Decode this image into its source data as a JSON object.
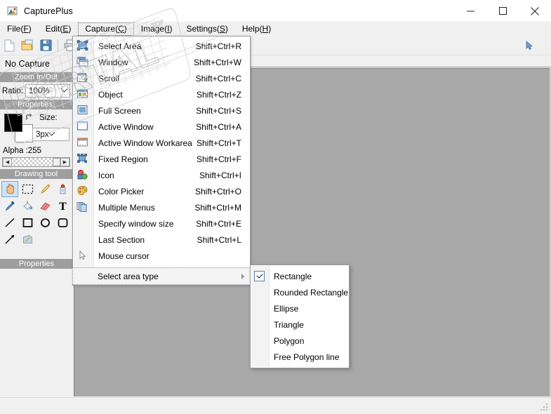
{
  "window": {
    "title": "CapturePlus",
    "app_icon": "app-logo-icon",
    "controls": {
      "minimize": "minimize-icon",
      "maximize": "maximize-icon",
      "close": "close-icon"
    }
  },
  "menubar": [
    {
      "label": "File(",
      "mnemonic": "F",
      "tail": ")",
      "name": "menu-file",
      "open": false
    },
    {
      "label": "Edit(",
      "mnemonic": "E",
      "tail": ")",
      "name": "menu-edit",
      "open": false
    },
    {
      "label": "Capture(",
      "mnemonic": "C",
      "tail": ")",
      "name": "menu-capture",
      "open": true
    },
    {
      "label": "Image(",
      "mnemonic": "I",
      "tail": ")",
      "name": "menu-image",
      "open": false
    },
    {
      "label": "Settings(",
      "mnemonic": "S",
      "tail": ")",
      "name": "menu-settings",
      "open": false
    },
    {
      "label": "Help(",
      "mnemonic": "H",
      "tail": ")",
      "name": "menu-help",
      "open": false
    }
  ],
  "toolbar": {
    "buttons": [
      {
        "name": "new-file-icon",
        "glyph": "new"
      },
      {
        "name": "open-file-icon",
        "glyph": "open"
      },
      {
        "name": "save-file-icon",
        "glyph": "save"
      },
      {
        "name": "print-icon",
        "glyph": "print"
      }
    ],
    "right_button": {
      "name": "pointer-tool-icon",
      "glyph": "pointer"
    }
  },
  "left_panel": {
    "capture_status": "No Capture",
    "zoom_section_title": "Zoom In/Out",
    "ratio_label": "Ratio:",
    "ratio_value": "100%",
    "properties_title": "Properties:",
    "size_label": "Size:",
    "size_value": "3px",
    "alpha_label": "Alpha :255",
    "alpha_value": 255,
    "foreground_color": "#000000",
    "background_color": "#ffffff",
    "drawing_tool_title": "Drawing tool",
    "properties_bottom_title": "Properties",
    "tools": [
      {
        "name": "hand-tool-icon",
        "glyph": "hand",
        "selected": true
      },
      {
        "name": "select-rect-tool-icon",
        "glyph": "marquee",
        "selected": false
      },
      {
        "name": "pencil-tool-icon",
        "glyph": "pencil",
        "selected": false
      },
      {
        "name": "spray-tool-icon",
        "glyph": "spray",
        "selected": false
      },
      {
        "name": "eyedropper-tool-icon",
        "glyph": "eyedropper",
        "selected": false
      },
      {
        "name": "paint-bucket-tool-icon",
        "glyph": "bucket",
        "selected": false
      },
      {
        "name": "eraser-tool-icon",
        "glyph": "eraser",
        "selected": false
      },
      {
        "name": "text-tool-icon",
        "glyph": "text",
        "selected": false
      },
      {
        "name": "line-tool-icon",
        "glyph": "line",
        "selected": false
      },
      {
        "name": "rectangle-tool-icon",
        "glyph": "rect",
        "selected": false
      },
      {
        "name": "ellipse-tool-icon",
        "glyph": "ellipse",
        "selected": false
      },
      {
        "name": "rounded-rect-tool-icon",
        "glyph": "roundrect",
        "selected": false
      },
      {
        "name": "arrow-tool-icon",
        "glyph": "arrow",
        "selected": false
      },
      {
        "name": "highlighter-tool-icon",
        "glyph": "highlight",
        "selected": false
      }
    ]
  },
  "capture_menu": {
    "items": [
      {
        "label": "Select Area",
        "accel": "Shift+Ctrl+R",
        "icon": "select-area-icon",
        "name": "menu-item-select-area"
      },
      {
        "label": "Window",
        "accel": "Shift+Ctrl+W",
        "icon": "window-icon",
        "name": "menu-item-window"
      },
      {
        "label": "Scroll",
        "accel": "Shift+Ctrl+C",
        "icon": "scroll-icon",
        "name": "menu-item-scroll"
      },
      {
        "label": "Object",
        "accel": "Shift+Ctrl+Z",
        "icon": "object-icon",
        "name": "menu-item-object"
      },
      {
        "label": "Full Screen",
        "accel": "Shift+Ctrl+S",
        "icon": "full-screen-icon",
        "name": "menu-item-full-screen"
      },
      {
        "label": "Active Window",
        "accel": "Shift+Ctrl+A",
        "icon": "active-window-icon",
        "name": "menu-item-active-window"
      },
      {
        "label": "Active Window Workarea",
        "accel": "Shift+Ctrl+T",
        "icon": "active-window-workarea-icon",
        "name": "menu-item-active-window-workarea"
      },
      {
        "label": "Fixed Region",
        "accel": "Shift+Ctrl+F",
        "icon": "fixed-region-icon",
        "name": "menu-item-fixed-region"
      },
      {
        "label": "Icon",
        "accel": "Shift+Ctrl+I",
        "icon": "icon-capture-icon",
        "name": "menu-item-icon"
      },
      {
        "label": "Color Picker",
        "accel": "Shift+Ctrl+O",
        "icon": "color-picker-icon",
        "name": "menu-item-color-picker"
      },
      {
        "label": "Multiple Menus",
        "accel": "Shift+Ctrl+M",
        "icon": "multiple-menus-icon",
        "name": "menu-item-multiple-menus"
      },
      {
        "label": "Specify window size",
        "accel": "Shift+Ctrl+E",
        "icon": "",
        "name": "menu-item-specify-window-size"
      },
      {
        "label": "Last Section",
        "accel": "Shift+Ctrl+L",
        "icon": "",
        "name": "menu-item-last-section"
      },
      {
        "label": "Mouse cursor",
        "accel": "",
        "icon": "mouse-cursor-icon",
        "name": "menu-item-mouse-cursor"
      }
    ],
    "submenu_parent": {
      "label": "Select area type",
      "name": "menu-item-select-area-type",
      "arrow": "chevron-right-icon"
    }
  },
  "area_type_submenu": {
    "items": [
      {
        "label": "Rectangle",
        "checked": true,
        "name": "submenu-item-rectangle"
      },
      {
        "label": "Rounded Rectangle",
        "checked": false,
        "name": "submenu-item-rounded-rectangle"
      },
      {
        "label": "Ellipse",
        "checked": false,
        "name": "submenu-item-ellipse"
      },
      {
        "label": "Triangle",
        "checked": false,
        "name": "submenu-item-triangle"
      },
      {
        "label": "Polygon",
        "checked": false,
        "name": "submenu-item-polygon"
      },
      {
        "label": "Free Polygon line",
        "checked": false,
        "name": "submenu-item-free-polygon-line"
      }
    ]
  },
  "watermark": {
    "text": "PORTAL",
    "subtext": "www.softportal.com",
    "corner_text": "TOP"
  },
  "colors": {
    "canvas": "#a8a8a8",
    "panel": "#f0f0f0",
    "section_header": "#9e9e9e",
    "menu_bg": "#ffffff",
    "selection": "#cce4f7"
  }
}
